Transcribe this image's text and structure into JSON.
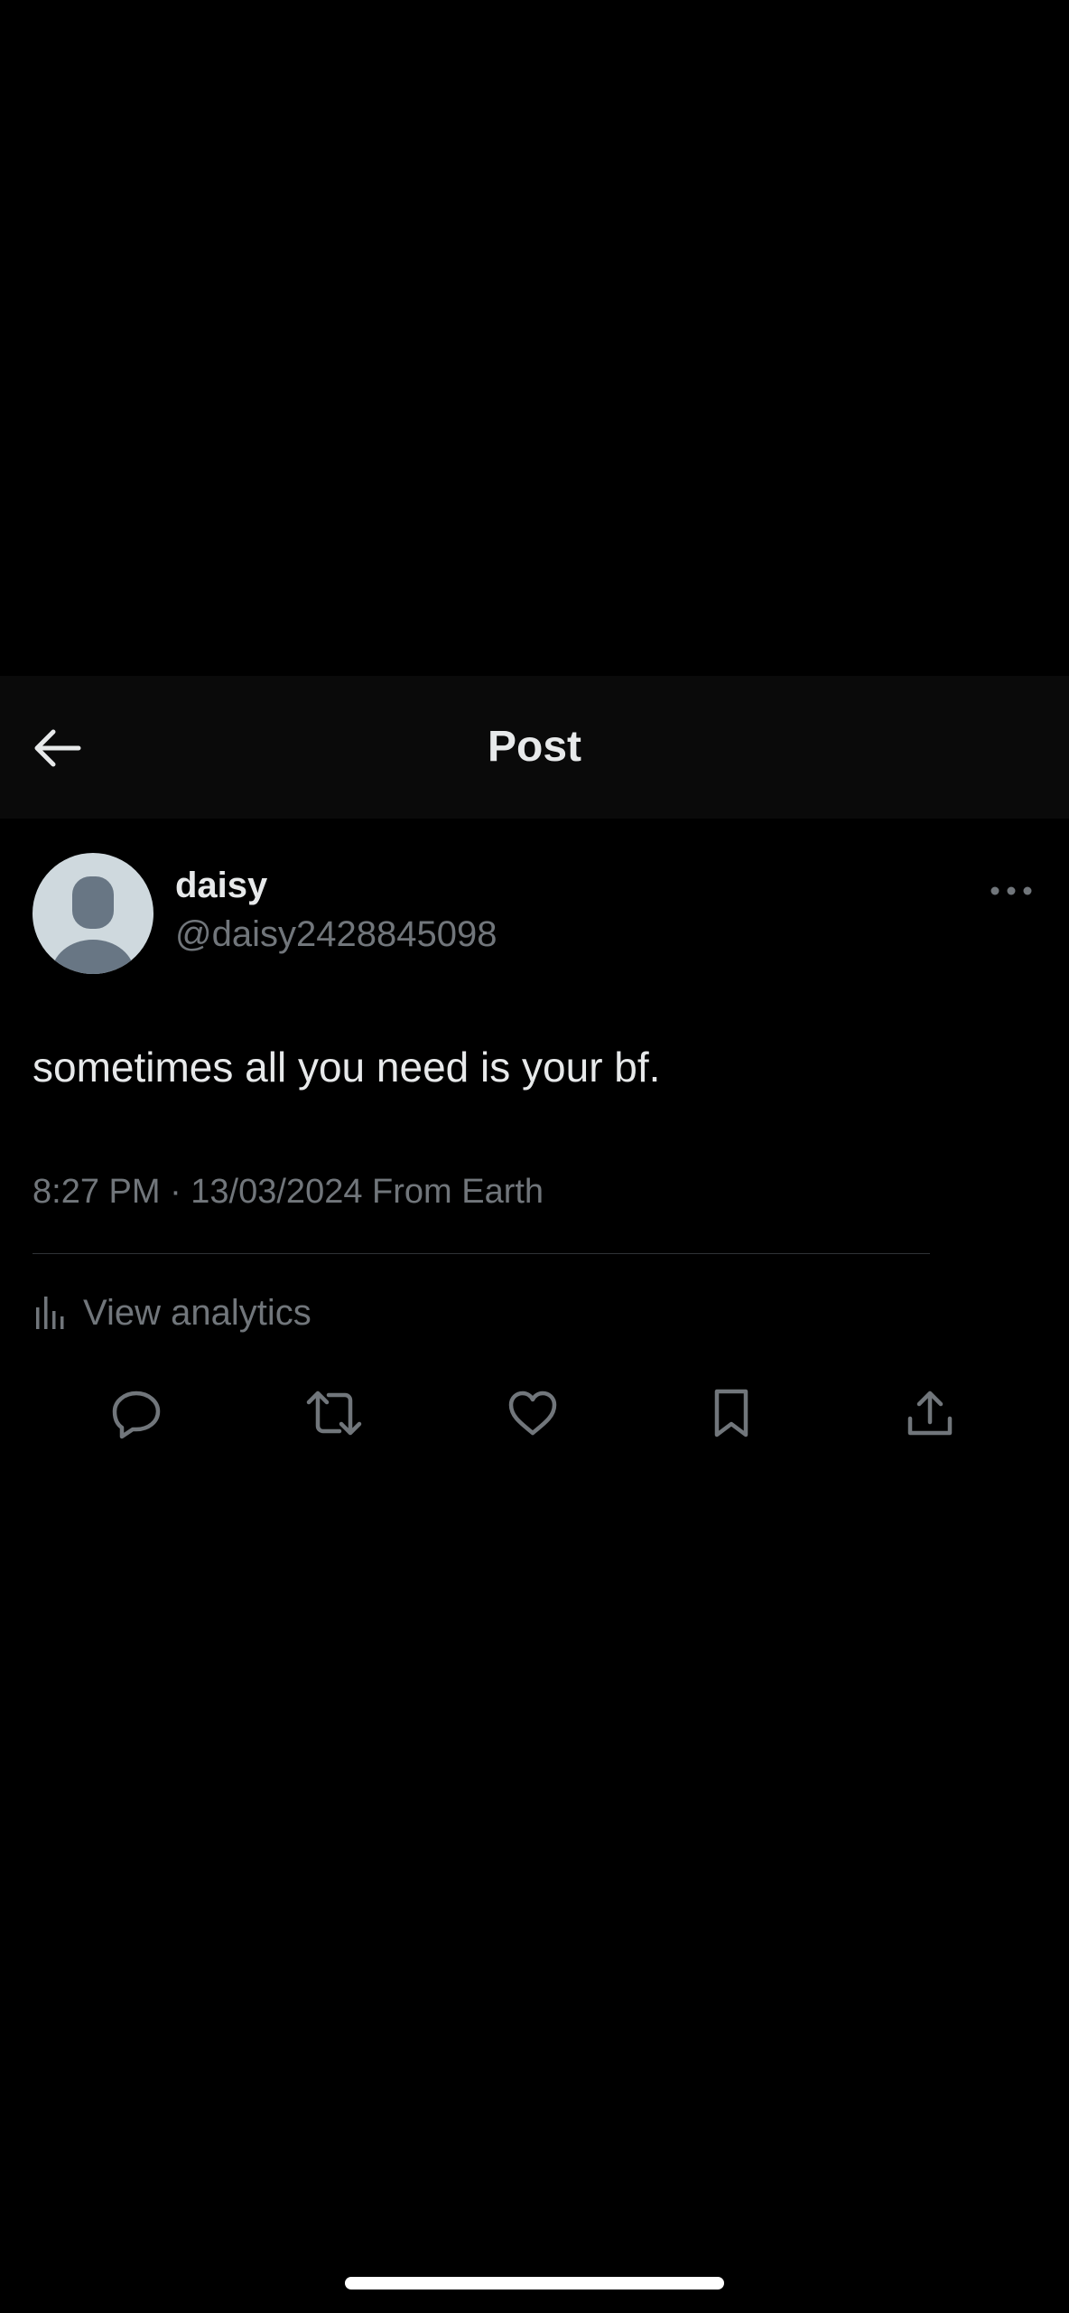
{
  "header": {
    "title": "Post",
    "back_icon": "arrow-left-icon"
  },
  "post": {
    "author": {
      "display_name": "daisy",
      "handle": "@daisy2428845098",
      "avatar": "default-avatar-icon"
    },
    "more_icon": "more-horizontal-icon",
    "text": "sometimes all you need is your bf.",
    "timestamp": "8:27 PM · 13/03/2024 From Earth",
    "analytics_label": "View analytics"
  },
  "actions": [
    {
      "name": "reply",
      "icon": "reply-icon"
    },
    {
      "name": "repost",
      "icon": "repost-icon"
    },
    {
      "name": "like",
      "icon": "heart-icon"
    },
    {
      "name": "bookmark",
      "icon": "bookmark-icon"
    },
    {
      "name": "share",
      "icon": "share-icon"
    }
  ],
  "colors": {
    "background": "#000000",
    "header_background": "#0a0a0a",
    "primary_text": "#e7e9ea",
    "secondary_text": "#71767b",
    "divider": "#2f3336",
    "avatar_background": "#cfd9de",
    "avatar_figure": "#687684"
  }
}
